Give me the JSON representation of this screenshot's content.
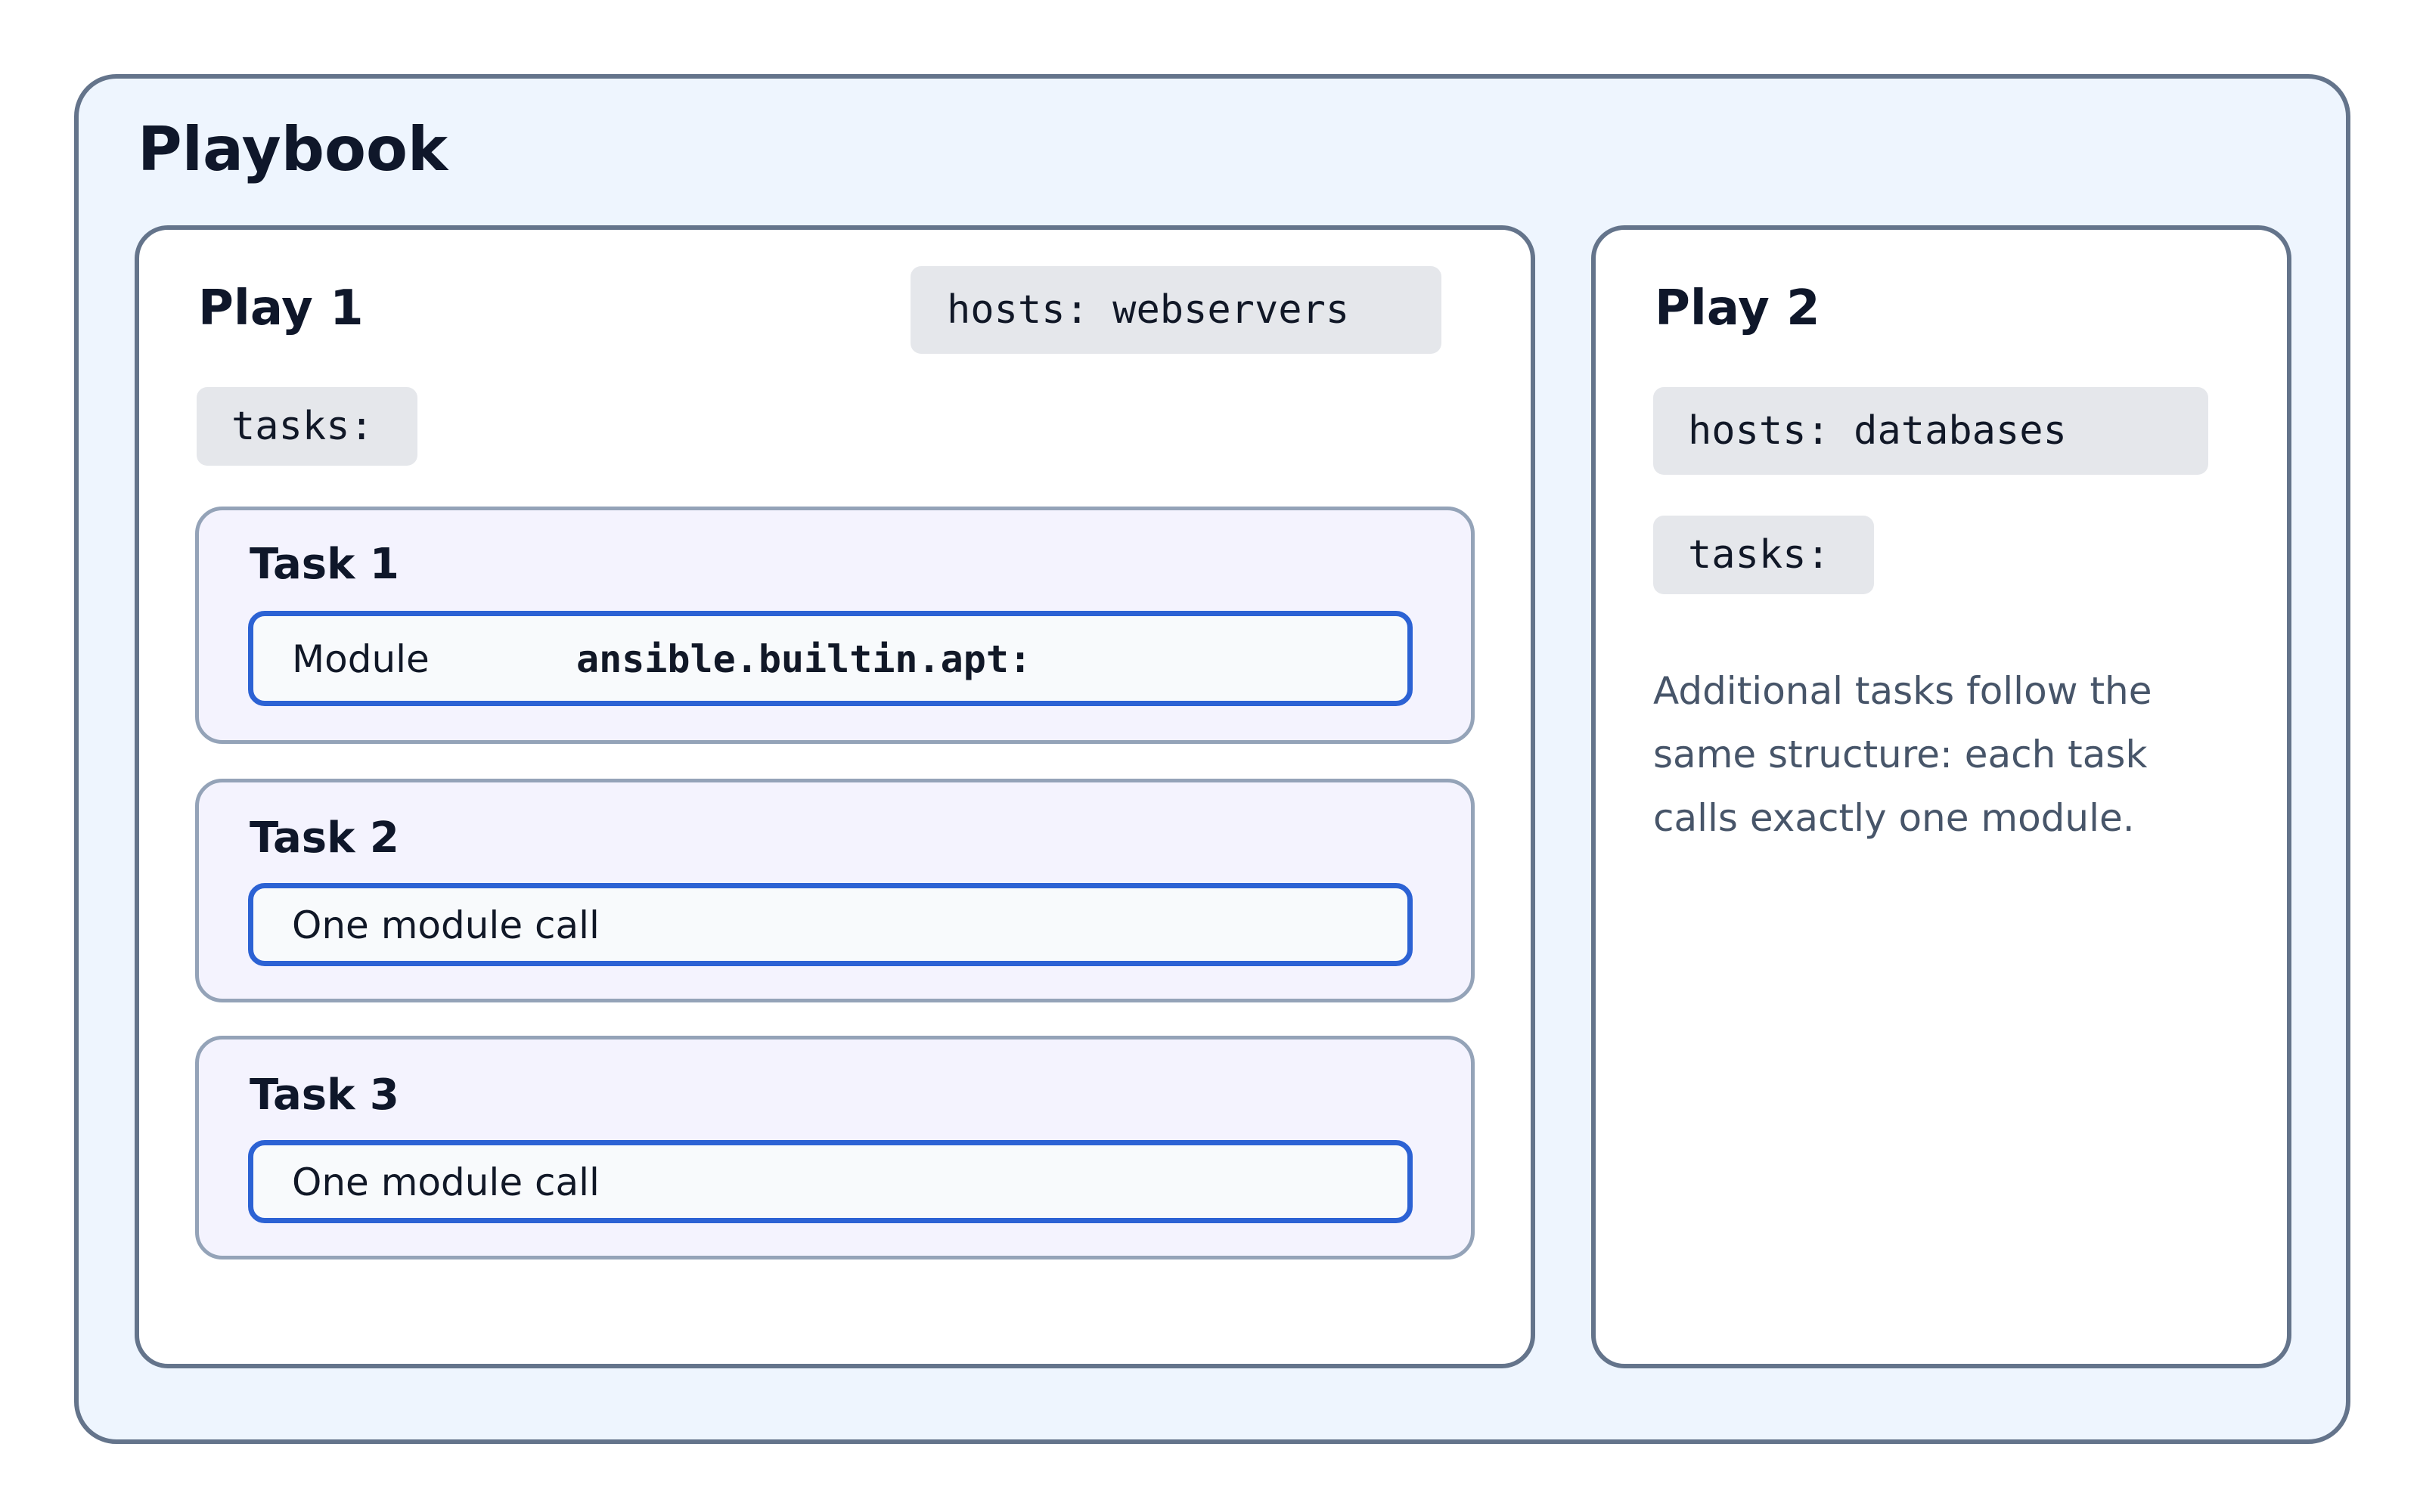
{
  "playbook": {
    "title": "Playbook",
    "plays": [
      {
        "title": "Play 1",
        "hosts": "hosts: webservers",
        "tasks_label": "tasks:",
        "tasks": [
          {
            "title": "Task 1",
            "module_label": "Module",
            "module_value": "ansible.builtin.apt:"
          },
          {
            "title": "Task 2",
            "module_text": "One module call"
          },
          {
            "title": "Task 3",
            "module_text": "One module call"
          }
        ]
      },
      {
        "title": "Play 2",
        "hosts": "hosts: databases",
        "tasks_label": "tasks:",
        "note": "Additional tasks follow the same structure: each task calls exactly one module."
      }
    ]
  },
  "colors": {
    "outer_border": "#64748b",
    "outer_fill": "#eef5fe",
    "task_border": "#94a3b8",
    "task_fill": "#f4f3fe",
    "module_border": "#2c62d4",
    "chip_fill": "#e5e7eb",
    "note_text": "#475569"
  }
}
